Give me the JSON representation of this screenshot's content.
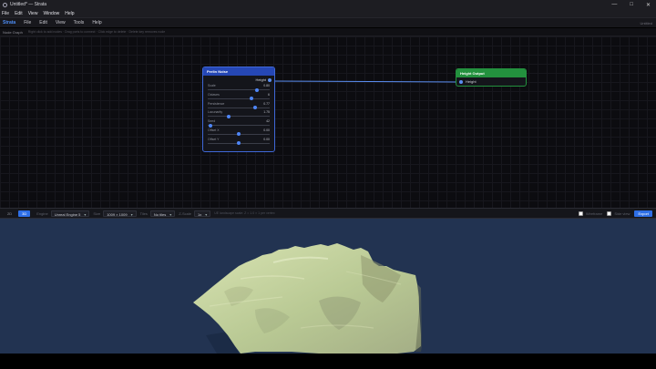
{
  "window": {
    "title": "Untitled* — Strata",
    "minimize": "—",
    "maximize": "□",
    "close": "✕"
  },
  "os_menu": [
    "File",
    "Edit",
    "View",
    "Window",
    "Help"
  ],
  "app_menu": {
    "brand": "Strata",
    "items": [
      "File",
      "Edit",
      "View",
      "Tools",
      "Help"
    ],
    "right_text": "Untitled"
  },
  "graph_header": {
    "title": "Node Graph",
    "hint": "Right click to add nodes · Drag ports to connect · Click edge to delete · Delete key removes node"
  },
  "nodes": {
    "perlin": {
      "title": "Perlin Noise",
      "output_label": "Height",
      "params": [
        {
          "label": "Scale",
          "value": "0.80",
          "fraction": 0.8
        },
        {
          "label": "Octaves",
          "value": "6",
          "fraction": 0.7
        },
        {
          "label": "Persistence",
          "value": "0.77",
          "fraction": 0.77
        },
        {
          "label": "Lacunarity",
          "value": "1.75",
          "fraction": 0.34
        },
        {
          "label": "Seed",
          "value": "42",
          "fraction": 0.04
        },
        {
          "label": "Offset X",
          "value": "0.00",
          "fraction": 0.5
        },
        {
          "label": "Offset Y",
          "value": "0.00",
          "fraction": 0.5
        }
      ]
    },
    "output": {
      "title": "Height Output",
      "input_label": "Height"
    }
  },
  "preview_toolbar": {
    "tab_2d": "2D",
    "tab_3d": "3D",
    "engine_label": "Engine",
    "engine_value": "Unreal Engine 5",
    "size_label": "Size",
    "size_value": "1009 × 1009",
    "tiles_label": "Tiles",
    "tiles_value": "No tiles",
    "scale_label": "Z-Scale",
    "scale_value": "1x",
    "info": "UE landscape scale: Z = 1.0 × 1 per vertex",
    "check1_label": "Wireframe",
    "check2_label": "Side view",
    "export_label": "Export",
    "caret": "▾"
  },
  "colors": {
    "accent": "#2e6fe6",
    "perlin_header": "#2547b5",
    "output_header": "#23913e",
    "terrain_light": "#cfdca8",
    "terrain_dark": "#56604a",
    "viewport_bg": "#223351"
  }
}
